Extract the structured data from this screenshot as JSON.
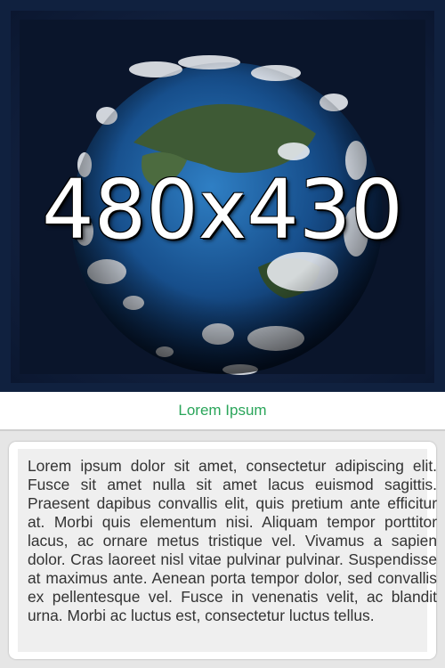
{
  "hero": {
    "placeholder_label": "480x430",
    "image_subject": "earth-globe-with-clouds"
  },
  "caption": {
    "title": "Lorem Ipsum",
    "color": "#2aa55a"
  },
  "card": {
    "body": "Lorem ipsum dolor sit amet, consectetur adipiscing elit. Fusce sit amet nulla sit amet lacus euismod sagittis. Praesent dapibus convallis elit, quis pretium ante efficitur at. Morbi quis elementum nisi. Aliquam tempor porttitor lacus, ac ornare metus tristique vel. Vivamus a sapien dolor. Cras laoreet nisl vitae pulvinar pulvinar. Suspendisse at maximus ante. Aenean porta tempor dolor, sed convallis ex pellentesque vel. Fusce in venenatis velit, ac blandit urna. Morbi ac luctus est, consectetur luctus tellus."
  }
}
